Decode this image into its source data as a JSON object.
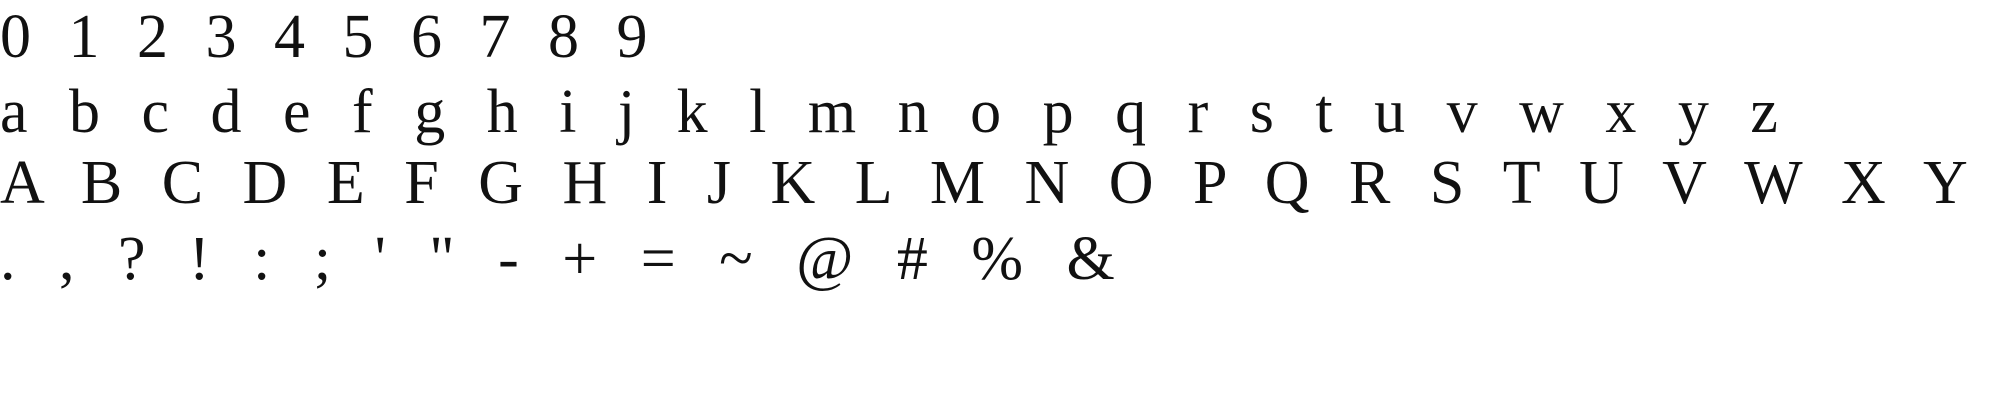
{
  "specimen": {
    "digits": "0 1 2 3 4 5 6 7 8 9",
    "lowercase": "a b c d e f g h i j k l m n o p q r s t u v w x y z",
    "uppercase": "A B C D E F G H I J K L M N O P Q R S T U V W X Y Z",
    "symbols": ". , ? ! : ; ' \" - + = ~ @ # % &"
  },
  "colors": {
    "background": "#ffffff",
    "text": "#111111"
  }
}
